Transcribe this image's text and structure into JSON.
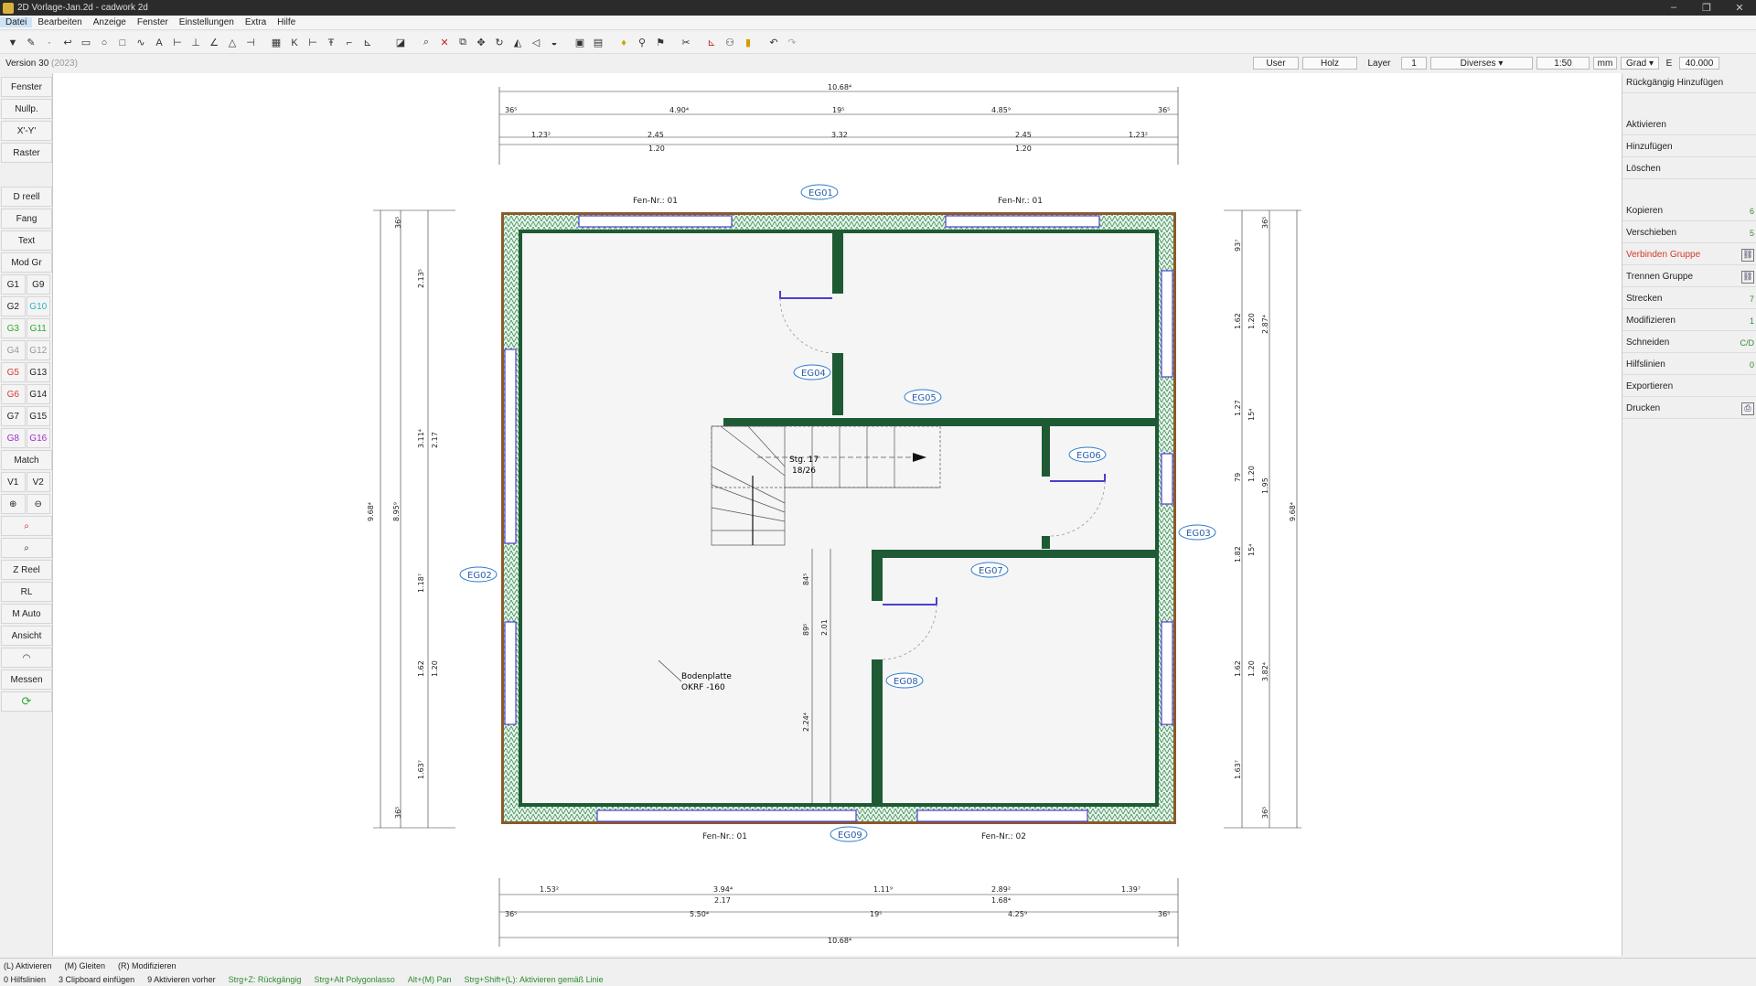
{
  "titlebar": {
    "title": "2D Vorlage-Jan.2d - cadwork 2d",
    "min": "–",
    "max": "❐",
    "close": "✕"
  },
  "menu": [
    "Datei",
    "Bearbeiten",
    "Anzeige",
    "Fenster",
    "Einstellungen",
    "Extra",
    "Hilfe"
  ],
  "status": {
    "version": "Version 30",
    "version_year": "(2023)",
    "user": "User",
    "material": "Holz",
    "layer_label": "Layer",
    "layer_value": "1",
    "diverses": "Diverses",
    "scale": "1:50",
    "unit": "mm",
    "angle": "Grad",
    "e_label": "E",
    "e_value": "40.000"
  },
  "left_panel": {
    "fenster": "Fenster",
    "nullp": "Nullp.",
    "xy": "X'-Y'",
    "raster": "Raster",
    "dreell": "D reell",
    "fang": "Fang",
    "text": "Text",
    "modgr": "Mod Gr",
    "g1": "G1",
    "g9": "G9",
    "g2": "G2",
    "g10": "G10",
    "g3": "G3",
    "g11": "G11",
    "g4": "G4",
    "g12": "G12",
    "g5": "G5",
    "g13": "G13",
    "g6": "G6",
    "g14": "G14",
    "g7": "G7",
    "g15": "G15",
    "g8": "G8",
    "g16": "G16",
    "match": "Match",
    "v1": "V1",
    "v2": "V2",
    "zreel": "Z Reel",
    "rl": "RL",
    "mauto": "M Auto",
    "ansicht": "Ansicht",
    "messen": "Messen",
    "colors": {
      "g10": "#2bb3c0",
      "g3": "#2eaa2e",
      "g11": "#2eaa2e",
      "g4": "#999999",
      "g12": "#999999",
      "g5": "#d33b3b",
      "g6": "#d33b3b",
      "g8": "#a02bd0",
      "g16": "#a02bd0"
    }
  },
  "right_panel": {
    "rueckgaengig": "Rückgängig Hinzufügen",
    "aktivieren": "Aktivieren",
    "hinzufuegen": "Hinzufügen",
    "loeschen": "Löschen",
    "kopieren": "Kopieren",
    "kopieren_key": "6",
    "verschieben": "Verschieben",
    "verschieben_key": "5",
    "verbinden": "Verbinden Gruppe",
    "trennen": "Trennen Gruppe",
    "strecken": "Strecken",
    "strecken_key": "7",
    "modifizieren": "Modifizieren",
    "modifizieren_key": "1",
    "schneiden": "Schneiden",
    "schneiden_key": "C/D",
    "hilfslinien": "Hilfslinien",
    "hilfslinien_key": "0",
    "exportieren": "Exportieren",
    "drucken": "Drucken"
  },
  "bottom": {
    "row1": [
      "(L) Aktivieren",
      "(M) Gleiten",
      "(R) Modifizieren"
    ],
    "row2a": "0 Hilfslinien",
    "row2b": "3 Clipboard einfügen",
    "row2c": "9 Aktivieren vorher",
    "row2d": "Strg+Z: Rückgängig",
    "row2e": "Strg+Alt Polygonlasso",
    "row2f": "Alt+(M) Pan",
    "row2g": "Strg+Shift+(L): Aktivieren gemäß Linie"
  },
  "drawing": {
    "labels": {
      "eg01": "EG01",
      "eg02": "EG02",
      "eg03": "EG03",
      "eg04": "EG04",
      "eg05": "EG05",
      "eg06": "EG06",
      "eg07": "EG07",
      "eg08": "EG08",
      "eg09": "EG09"
    },
    "fen_top_left": "Fen-Nr.: 01",
    "fen_top_right": "Fen-Nr.: 01",
    "fen_bottom_left": "Fen-Nr.: 01",
    "fen_bottom_right": "Fen-Nr.: 02",
    "bodenplatte": "Bodenplatte",
    "okrf": "OKRF -160",
    "stairs_1": "Stg. 17",
    "stairs_2": "18/26",
    "dims_top": {
      "total": "10.68⁴",
      "a": "36⁵",
      "b": "4.90⁴",
      "c": "19⁵",
      "d": "4.85⁹",
      "e": "36⁵",
      "f": "1.23²",
      "g": "2.45",
      "h": "3.32",
      "i": "2.45",
      "j": "1.23²",
      "k": "1.20",
      "l": "1.20"
    },
    "dims_bottom": {
      "a": "1.53²",
      "b": "3.94⁴",
      "c": "1.11⁹",
      "d": "2.89²",
      "e": "1.39⁷",
      "f": "2.17",
      "g": "1.68⁴",
      "h": "36⁵",
      "i": "5.50⁴",
      "j": "19⁵",
      "k": "4.25⁹",
      "l": "36⁵",
      "total": "10.68⁴"
    },
    "dims_left": {
      "total": "9.68⁴",
      "a": "36⁵",
      "b": "2.13⁵",
      "c": "3.11⁴",
      "d": "2.17",
      "e": "1.18⁷",
      "f": "1.62",
      "g": "1.20",
      "h": "1.63⁷",
      "i": "36⁵",
      "j": "8.95⁹"
    },
    "dims_right": {
      "total": "9.68⁴",
      "a": "36⁵",
      "b": "93⁷",
      "c": "1.62",
      "d": "1.20",
      "e": "2.87⁴",
      "f": "1.27",
      "g": "15⁴",
      "h": "79",
      "i": "1.20",
      "j": "1.95",
      "k": "1.82",
      "l": "15⁴",
      "m": "1.62",
      "n": "1.20",
      "o": "3.82⁴",
      "p": "1.63⁷",
      "q": "36⁵"
    },
    "dims_inner": {
      "a": "84⁵",
      "b": "89⁵",
      "c": "2.01",
      "d": "2.24⁴"
    }
  }
}
